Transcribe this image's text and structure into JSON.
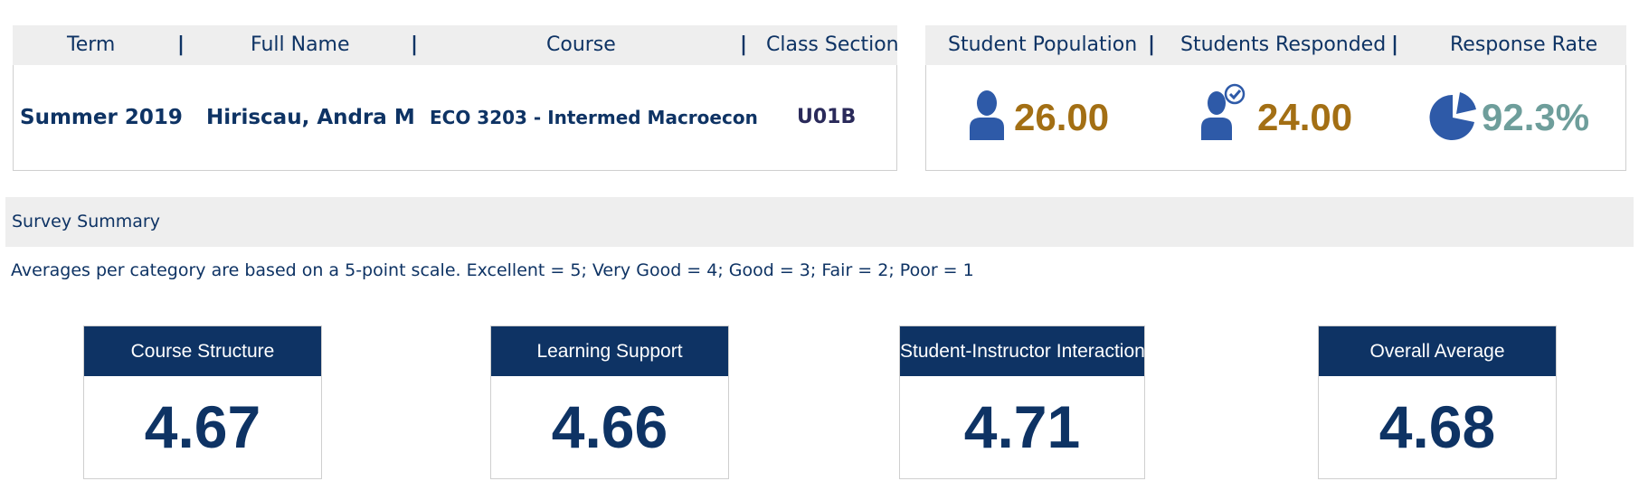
{
  "course_info": {
    "headers": {
      "term": "Term",
      "full_name": "Full Name",
      "course": "Course",
      "class_section": "Class Section"
    },
    "values": {
      "term": "Summer 2019",
      "full_name": "Hiriscau, Andra M",
      "course": "ECO 3203 - Intermed Macroecon",
      "class_section": "U01B"
    },
    "separator": "|"
  },
  "response_info": {
    "headers": {
      "population": "Student Population",
      "responded": "Students Responded",
      "rate": "Response Rate"
    },
    "values": {
      "population": "26.00",
      "responded": "24.00",
      "rate": "92.3%"
    },
    "icons": [
      "person-icon",
      "person-check-icon",
      "pie-chart-icon"
    ],
    "colors": {
      "count": "#a36f14",
      "rate": "#6e9e9b",
      "icon": "#2e5aa8"
    }
  },
  "summary": {
    "title": "Survey Summary",
    "note": "Averages per category are based on a 5-point scale. Excellent = 5; Very Good = 4; Good = 3; Fair = 2; Poor = 1"
  },
  "categories": [
    {
      "label": "Course Structure",
      "value": "4.67"
    },
    {
      "label": "Learning Support",
      "value": "4.66"
    },
    {
      "label": "Student-Instructor Interaction",
      "value": "4.71"
    },
    {
      "label": "Overall Average",
      "value": "4.68"
    }
  ],
  "colors": {
    "navy": "#0e3364",
    "header_bg": "#eeeeee"
  }
}
